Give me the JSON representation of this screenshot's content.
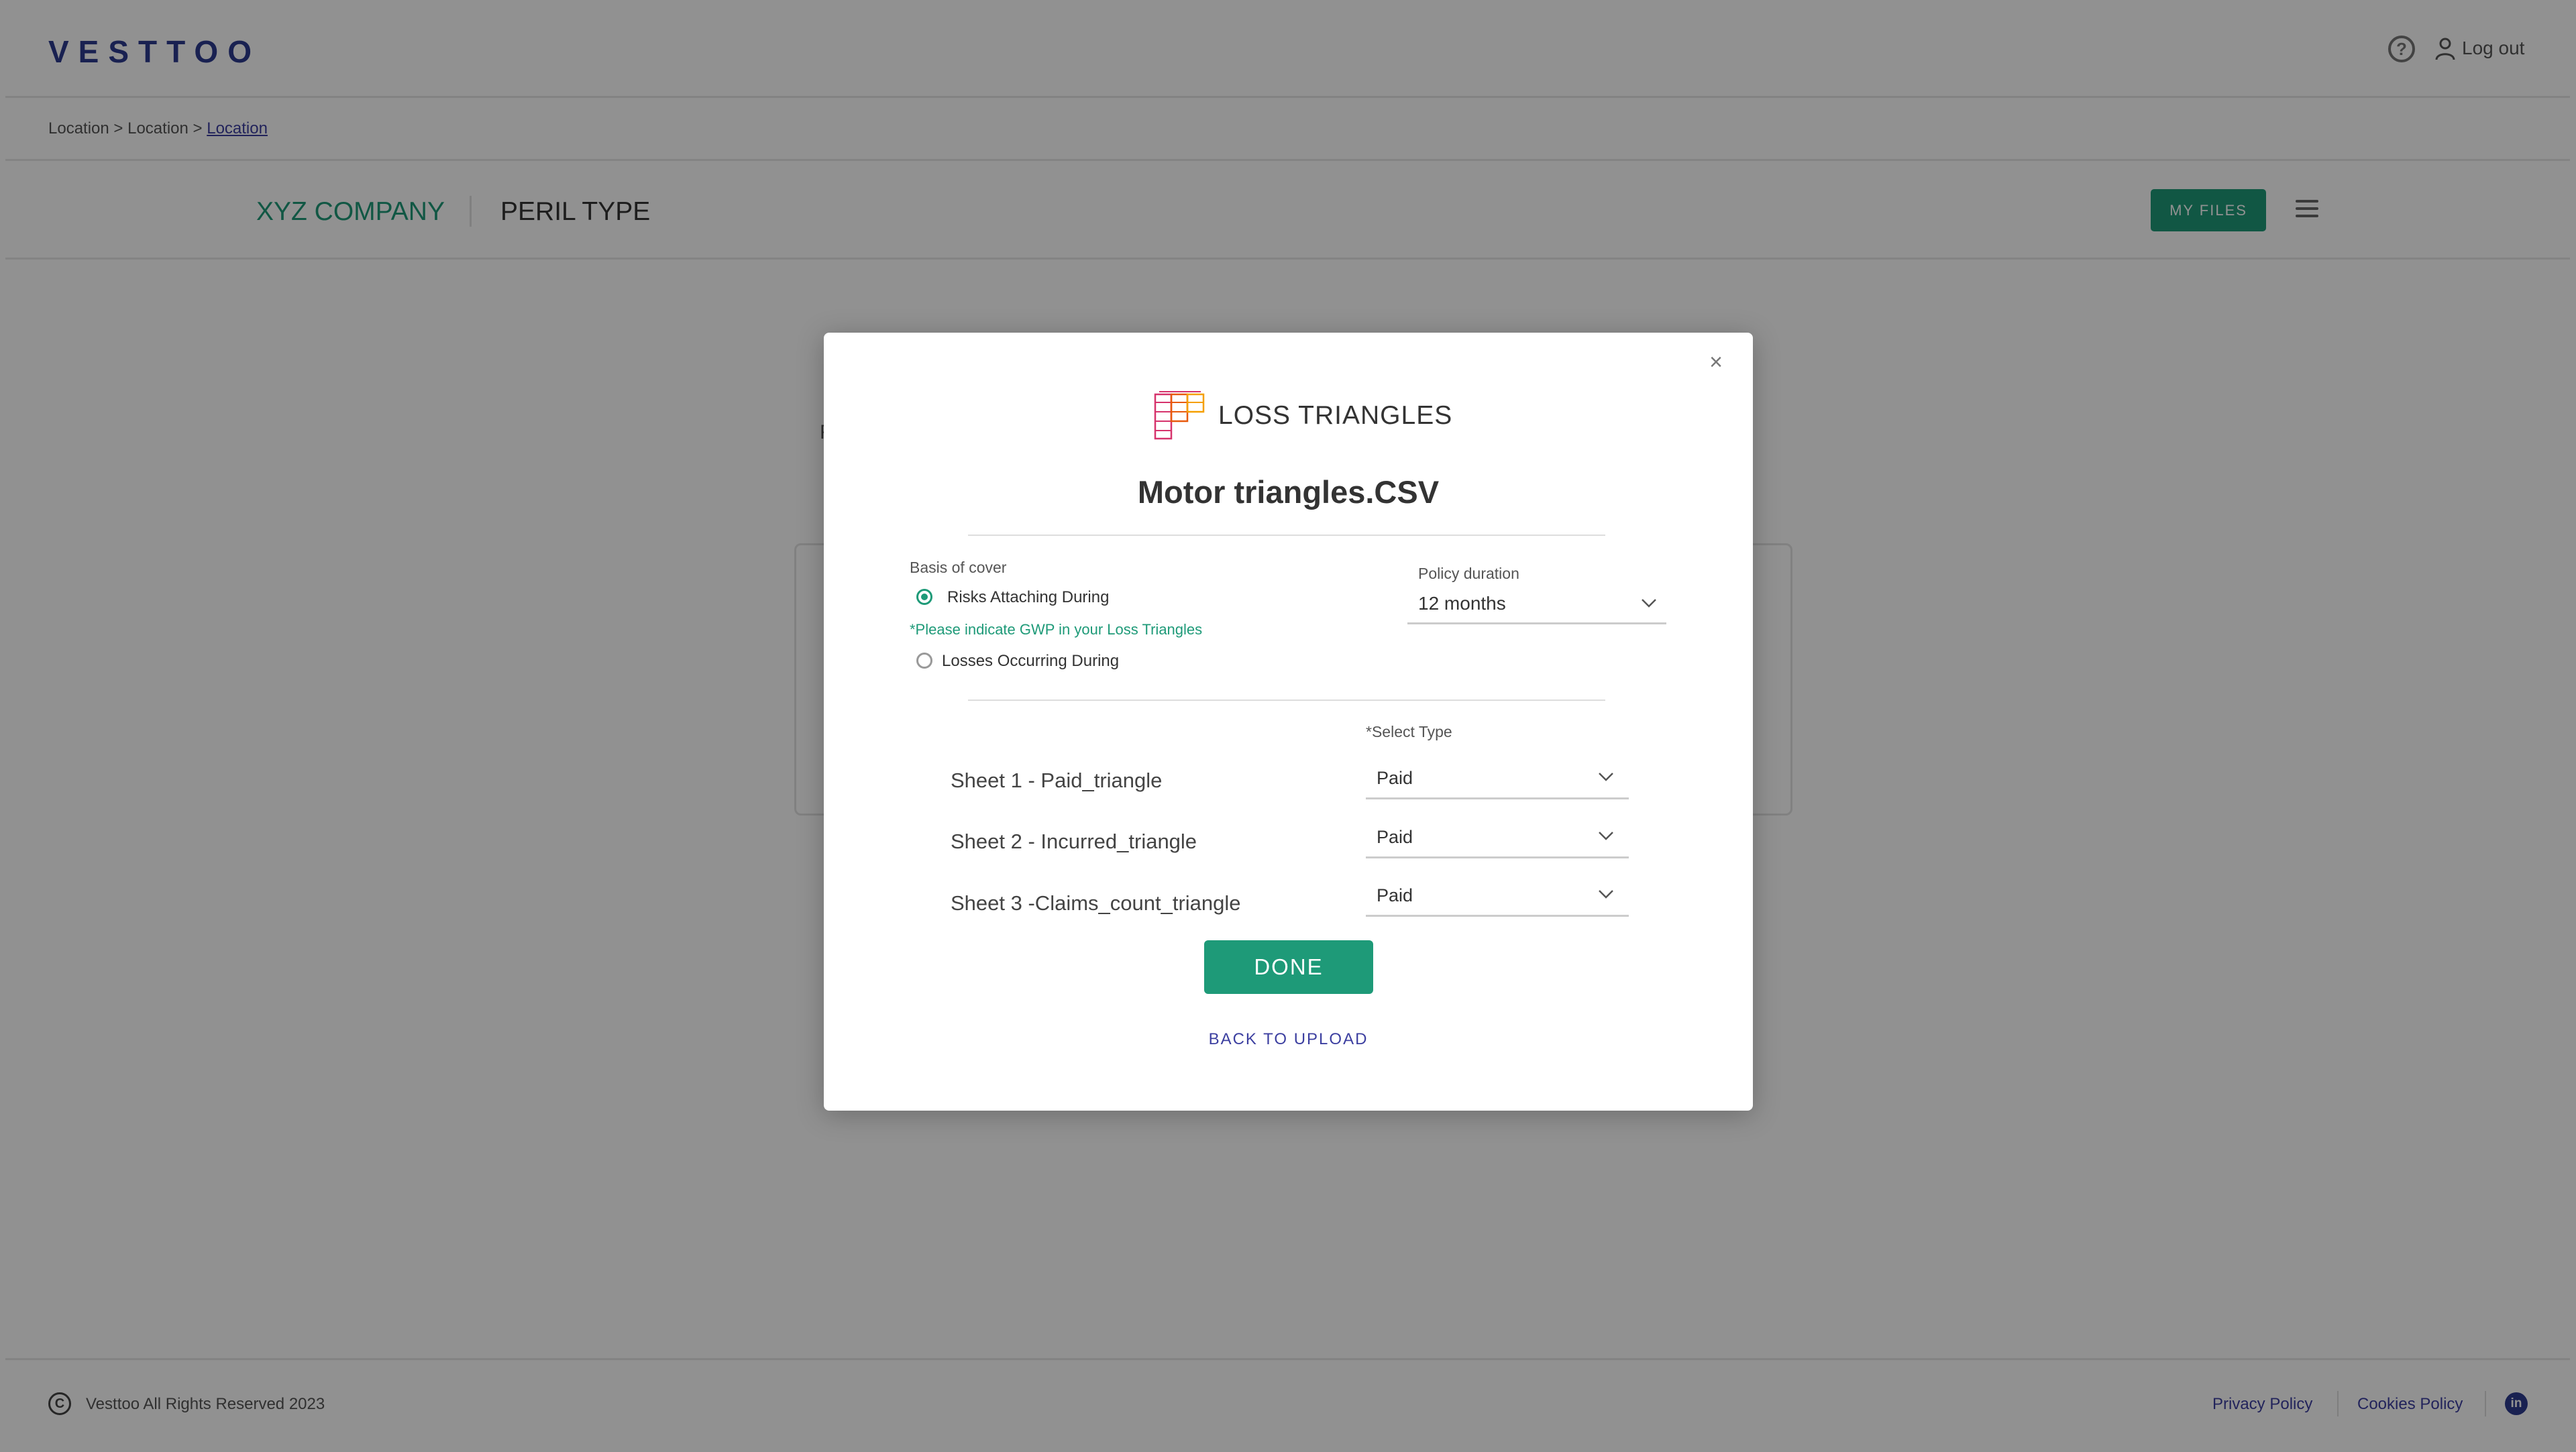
{
  "header": {
    "logo": "VESTTOO",
    "help_icon": "question-circle-icon",
    "user_icon": "user-icon",
    "logout_label": "Log out"
  },
  "breadcrumb": {
    "items": [
      "Location",
      "Location",
      "Location"
    ],
    "separator": ">"
  },
  "subheader": {
    "company": "XYZ COMPANY",
    "peril": "PERIL TYPE",
    "my_files_label": "MY FILES",
    "menu_icon": "hamburger-menu-icon"
  },
  "footer": {
    "copyright_icon": "copyright-icon",
    "copyright": "Vesttoo All Rights Reserved 2023",
    "privacy": "Privacy Policy",
    "cookies": "Cookies Policy",
    "linkedin_icon": "linkedin-icon"
  },
  "modal": {
    "close_icon": "close-icon",
    "header_icon": "spreadsheet-icon",
    "title": "LOSS TRIANGLES",
    "filename": "Motor triangles.CSV",
    "basis_of_cover_label": "Basis of cover",
    "basis_options": [
      {
        "label": "Risks Attaching During",
        "selected": true
      },
      {
        "label": "Losses Occurring During",
        "selected": false
      }
    ],
    "gwp_note": "*Please indicate GWP in your Loss Triangles",
    "policy_duration_label": "Policy duration",
    "policy_duration_value": "12 months",
    "select_type_label": "*Select Type",
    "sheets": [
      {
        "name": "Sheet 1 - Paid_triangle",
        "type": "Paid"
      },
      {
        "name": "Sheet 2 - Incurred_triangle",
        "type": "Paid"
      },
      {
        "name": "Sheet 3 -Claims_count_triangle",
        "type": "Paid"
      }
    ],
    "done_label": "DONE",
    "back_label": "BACK TO UPLOAD"
  },
  "colors": {
    "brand_green": "#1e9a78",
    "brand_blue": "#2d3a8f",
    "link_blue": "#3c3fa0",
    "overlay": "rgba(0,0,0,0.43)"
  }
}
